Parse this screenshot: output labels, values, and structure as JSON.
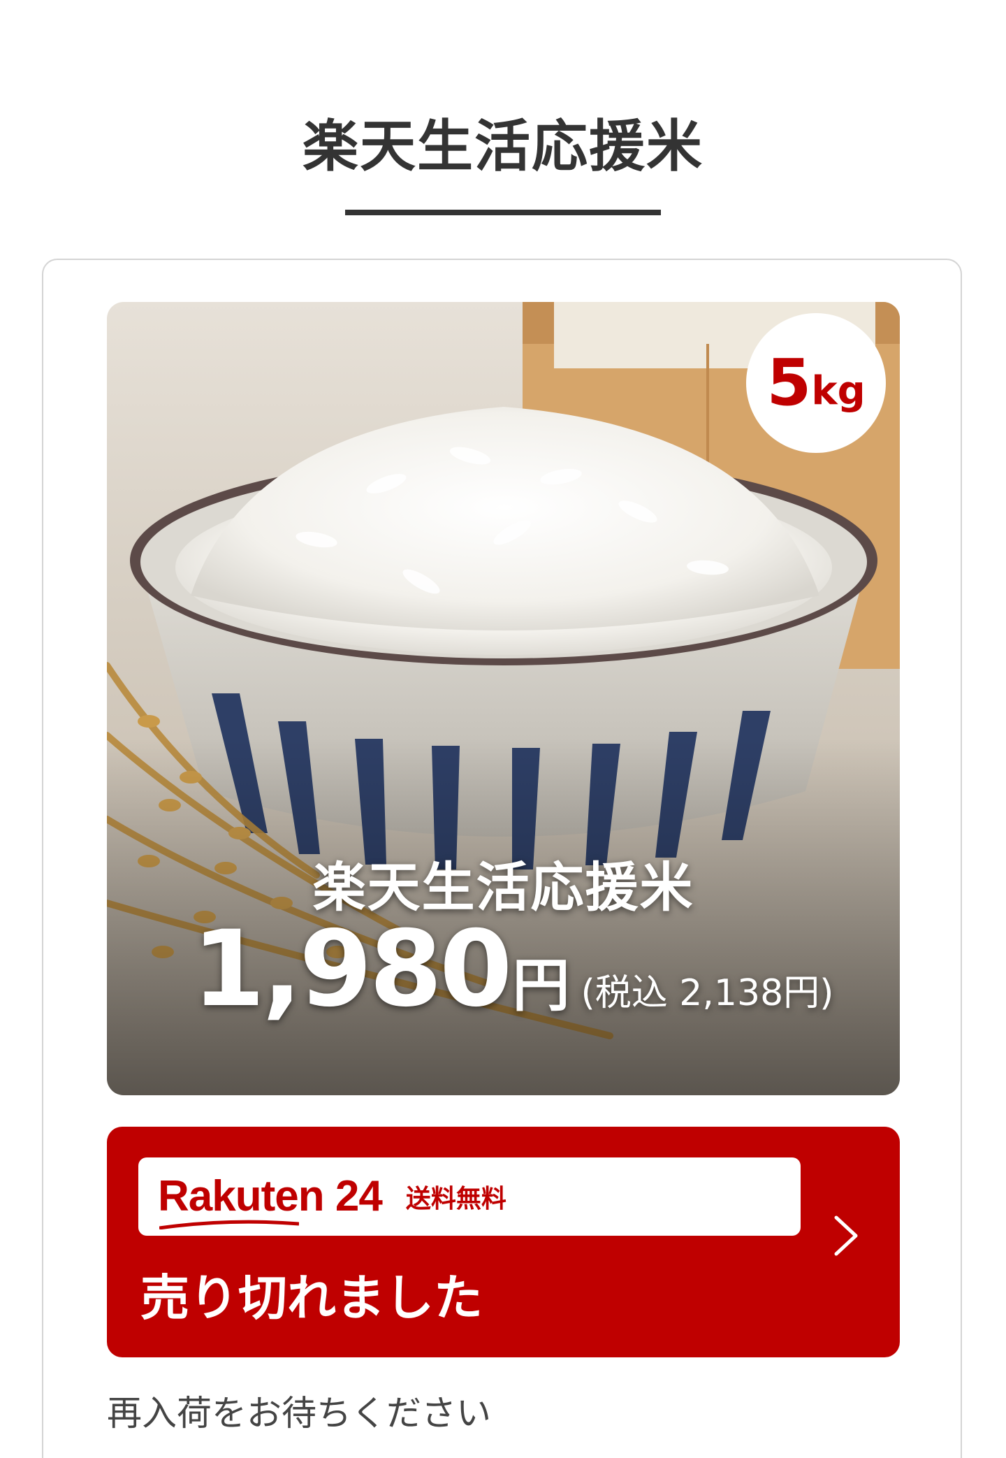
{
  "header": {
    "title": "楽天生活応援米"
  },
  "product": {
    "weight_number": "5",
    "weight_unit": "kg",
    "image_title": "楽天生活応援米",
    "price_amount": "1,980",
    "price_yen": "円",
    "price_tax": "(税込 2,138円)"
  },
  "cta": {
    "brand_name": "Rakuten 24",
    "shipping_label": "送料無料",
    "status_label": "売り切れました",
    "chevron_icon": "chevron-right-icon"
  },
  "restock_note": "再入荷をお待ちください",
  "colors": {
    "brand_red": "#bf0000",
    "heading_text": "#333333",
    "card_border": "#d4d4d4"
  }
}
